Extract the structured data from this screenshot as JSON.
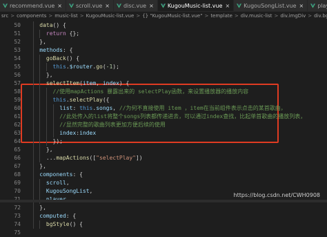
{
  "tabs": [
    {
      "label": "recommend.vue",
      "active": false
    },
    {
      "label": "scroll.vue",
      "active": false
    },
    {
      "label": "disc.vue",
      "active": false
    },
    {
      "label": "KugouMusic-list.vue",
      "active": true
    },
    {
      "label": "KugouSongList.vue",
      "active": false
    },
    {
      "label": "player.vue",
      "active": false
    }
  ],
  "close_glyph": "×",
  "breadcrumb": [
    "src",
    "components",
    "music-list",
    "KugouMusic-list.vue",
    "{} \"KugouMusic-list.vue\"",
    "template",
    "div.music-list",
    "div.imgDiv",
    "div.bgImg"
  ],
  "breadcrumb_sep": ">",
  "code_lines": [
    {
      "n": "50",
      "indent": 4,
      "tokens": [
        {
          "t": "data",
          "c": "fn"
        },
        {
          "t": "() {",
          "c": "pl"
        }
      ]
    },
    {
      "n": "51",
      "indent": 6,
      "tokens": [
        {
          "t": "return",
          "c": "k"
        },
        {
          "t": " {};",
          "c": "pl"
        }
      ]
    },
    {
      "n": "52",
      "indent": 4,
      "tokens": [
        {
          "t": "},",
          "c": "pl"
        }
      ]
    },
    {
      "n": "53",
      "indent": 4,
      "tokens": [
        {
          "t": "methods",
          "c": "vr"
        },
        {
          "t": ": {",
          "c": "pl"
        }
      ]
    },
    {
      "n": "54",
      "indent": 6,
      "tokens": [
        {
          "t": "goBack",
          "c": "fn"
        },
        {
          "t": "() {",
          "c": "pl"
        }
      ]
    },
    {
      "n": "55",
      "indent": 8,
      "tokens": [
        {
          "t": "this",
          "c": "kb"
        },
        {
          "t": ".",
          "c": "pl"
        },
        {
          "t": "$router",
          "c": "vr"
        },
        {
          "t": ".",
          "c": "pl"
        },
        {
          "t": "go",
          "c": "fn"
        },
        {
          "t": "(",
          "c": "pl"
        },
        {
          "t": "-1",
          "c": "num"
        },
        {
          "t": ");",
          "c": "pl"
        }
      ]
    },
    {
      "n": "56",
      "indent": 6,
      "tokens": [
        {
          "t": "},",
          "c": "pl"
        }
      ]
    },
    {
      "n": "57",
      "indent": 6,
      "tokens": [
        {
          "t": "selectItem",
          "c": "fn"
        },
        {
          "t": "(",
          "c": "pl"
        },
        {
          "t": "item",
          "c": "vr"
        },
        {
          "t": ", ",
          "c": "pl"
        },
        {
          "t": "index",
          "c": "vr"
        },
        {
          "t": ") {",
          "c": "pl"
        }
      ]
    },
    {
      "n": "58",
      "indent": 8,
      "tokens": [
        {
          "t": "//使用mapActions 暴露出来的 selectPlay函数，来设置播放器的播放内容",
          "c": "cm"
        }
      ]
    },
    {
      "n": "59",
      "indent": 8,
      "tokens": [
        {
          "t": "this",
          "c": "kb"
        },
        {
          "t": ".",
          "c": "pl"
        },
        {
          "t": "selectPlay",
          "c": "fn"
        },
        {
          "t": "({",
          "c": "pl"
        }
      ]
    },
    {
      "n": "60",
      "indent": 10,
      "tokens": [
        {
          "t": "list",
          "c": "vr"
        },
        {
          "t": ": ",
          "c": "pl"
        },
        {
          "t": "this",
          "c": "kb"
        },
        {
          "t": ".",
          "c": "pl"
        },
        {
          "t": "songs",
          "c": "vr"
        },
        {
          "t": ", ",
          "c": "pl"
        },
        {
          "t": "//为何不直接使用 item ，item在当前组件表示点击的某首歌曲，",
          "c": "cm"
        }
      ]
    },
    {
      "n": "61",
      "indent": 10,
      "tokens": [
        {
          "t": "//此处传入的list将整个songs列表都传递进去，可以通过index查找，比起单首歌曲的播放列表，",
          "c": "cm"
        }
      ]
    },
    {
      "n": "62",
      "indent": 10,
      "tokens": [
        {
          "t": "//显然完整的歌曲列表更加方便后续的使用",
          "c": "cm"
        }
      ]
    },
    {
      "n": "63",
      "indent": 10,
      "tokens": [
        {
          "t": "index",
          "c": "vr"
        },
        {
          "t": ":",
          "c": "pl"
        },
        {
          "t": "index",
          "c": "vr"
        }
      ]
    },
    {
      "n": "64",
      "indent": 8,
      "tokens": [
        {
          "t": "});",
          "c": "pl"
        }
      ]
    },
    {
      "n": "65",
      "indent": 6,
      "tokens": [
        {
          "t": "},",
          "c": "pl"
        }
      ]
    },
    {
      "n": "66",
      "indent": 6,
      "tokens": [
        {
          "t": "...",
          "c": "pl"
        },
        {
          "t": "mapActions",
          "c": "fn"
        },
        {
          "t": "([",
          "c": "pl"
        },
        {
          "t": "\"selectPlay\"",
          "c": "str"
        },
        {
          "t": "])",
          "c": "pl"
        }
      ]
    },
    {
      "n": "67",
      "indent": 4,
      "tokens": [
        {
          "t": "},",
          "c": "pl"
        }
      ]
    },
    {
      "n": "68",
      "indent": 4,
      "tokens": [
        {
          "t": "components",
          "c": "vr"
        },
        {
          "t": ": {",
          "c": "pl"
        }
      ]
    },
    {
      "n": "69",
      "indent": 6,
      "tokens": [
        {
          "t": "scroll",
          "c": "vr"
        },
        {
          "t": ",",
          "c": "pl"
        }
      ]
    },
    {
      "n": "70",
      "indent": 6,
      "tokens": [
        {
          "t": "KugouSongList",
          "c": "vr"
        },
        {
          "t": ",",
          "c": "pl"
        }
      ]
    },
    {
      "n": "71",
      "indent": 6,
      "tokens": [
        {
          "t": "player",
          "c": "vr"
        }
      ]
    },
    {
      "n": "72",
      "indent": 4,
      "tokens": [
        {
          "t": "},",
          "c": "pl"
        }
      ]
    },
    {
      "n": "73",
      "indent": 4,
      "tokens": [
        {
          "t": "computed",
          "c": "vr"
        },
        {
          "t": ": {",
          "c": "pl"
        }
      ]
    },
    {
      "n": "74",
      "indent": 6,
      "tokens": [
        {
          "t": "bgStyle",
          "c": "fn"
        },
        {
          "t": "() {",
          "c": "pl"
        }
      ]
    },
    {
      "n": "75",
      "indent": 0,
      "tokens": []
    }
  ],
  "watermark": "https://blog.csdn.net/CWH0908",
  "colors": {
    "editor_bg": "#1e1e1e",
    "highlight_box": "#e03b22",
    "comment": "#6a9955",
    "keyword": "#c586c0",
    "function": "#dcdcaa",
    "variable": "#9cdcfe",
    "string": "#ce9178"
  }
}
